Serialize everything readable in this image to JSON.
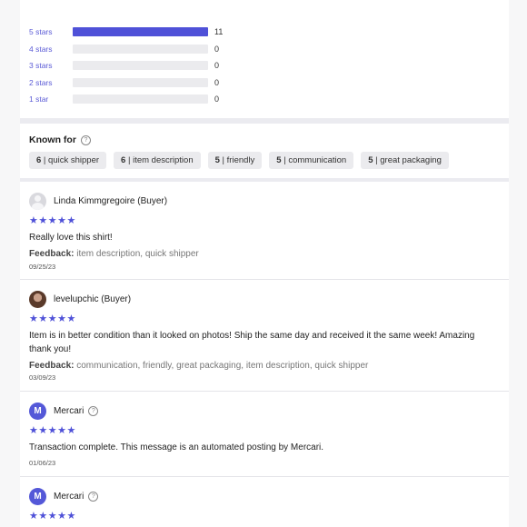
{
  "rating_distribution": [
    {
      "label": "5 stars",
      "count": "11",
      "fraction": 1.0
    },
    {
      "label": "4 stars",
      "count": "0",
      "fraction": 0
    },
    {
      "label": "3 stars",
      "count": "0",
      "fraction": 0
    },
    {
      "label": "2 stars",
      "count": "0",
      "fraction": 0
    },
    {
      "label": "1 star",
      "count": "0",
      "fraction": 0
    }
  ],
  "known_for": {
    "title": "Known for",
    "chips": [
      {
        "count": "6",
        "label": "quick shipper"
      },
      {
        "count": "6",
        "label": "item description"
      },
      {
        "count": "5",
        "label": "friendly"
      },
      {
        "count": "5",
        "label": "communication"
      },
      {
        "count": "5",
        "label": "great packaging"
      }
    ]
  },
  "reviews": [
    {
      "name": "Linda Kimmgregoire (Buyer)",
      "avatar": "person-placeholder-icon",
      "stars": "★★★★★",
      "text": "Really love this shirt!",
      "feedback_label": "Feedback:",
      "feedback": "item description, quick shipper",
      "date": "09/25/23"
    },
    {
      "name": "levelupchic (Buyer)",
      "avatar": "user-photo",
      "stars": "★★★★★",
      "text": "Item is in better condition than it looked on photos! Ship the same day and received it the same week! Amazing thank you!",
      "feedback_label": "Feedback:",
      "feedback": "communication, friendly, great packaging, item description, quick shipper",
      "date": "03/09/23"
    },
    {
      "name": "Mercari",
      "avatar": "mercari-logo",
      "avatar_letter": "M",
      "stars": "★★★★★",
      "text": "Transaction complete. This message is an automated posting by Mercari.",
      "date": "01/06/23"
    },
    {
      "name": "Mercari",
      "avatar": "mercari-logo",
      "avatar_letter": "M",
      "stars": "★★★★★"
    }
  ],
  "colors": {
    "accent": "#4f51d8",
    "chip_bg": "#ebebee",
    "divider": "#ebebf0"
  }
}
